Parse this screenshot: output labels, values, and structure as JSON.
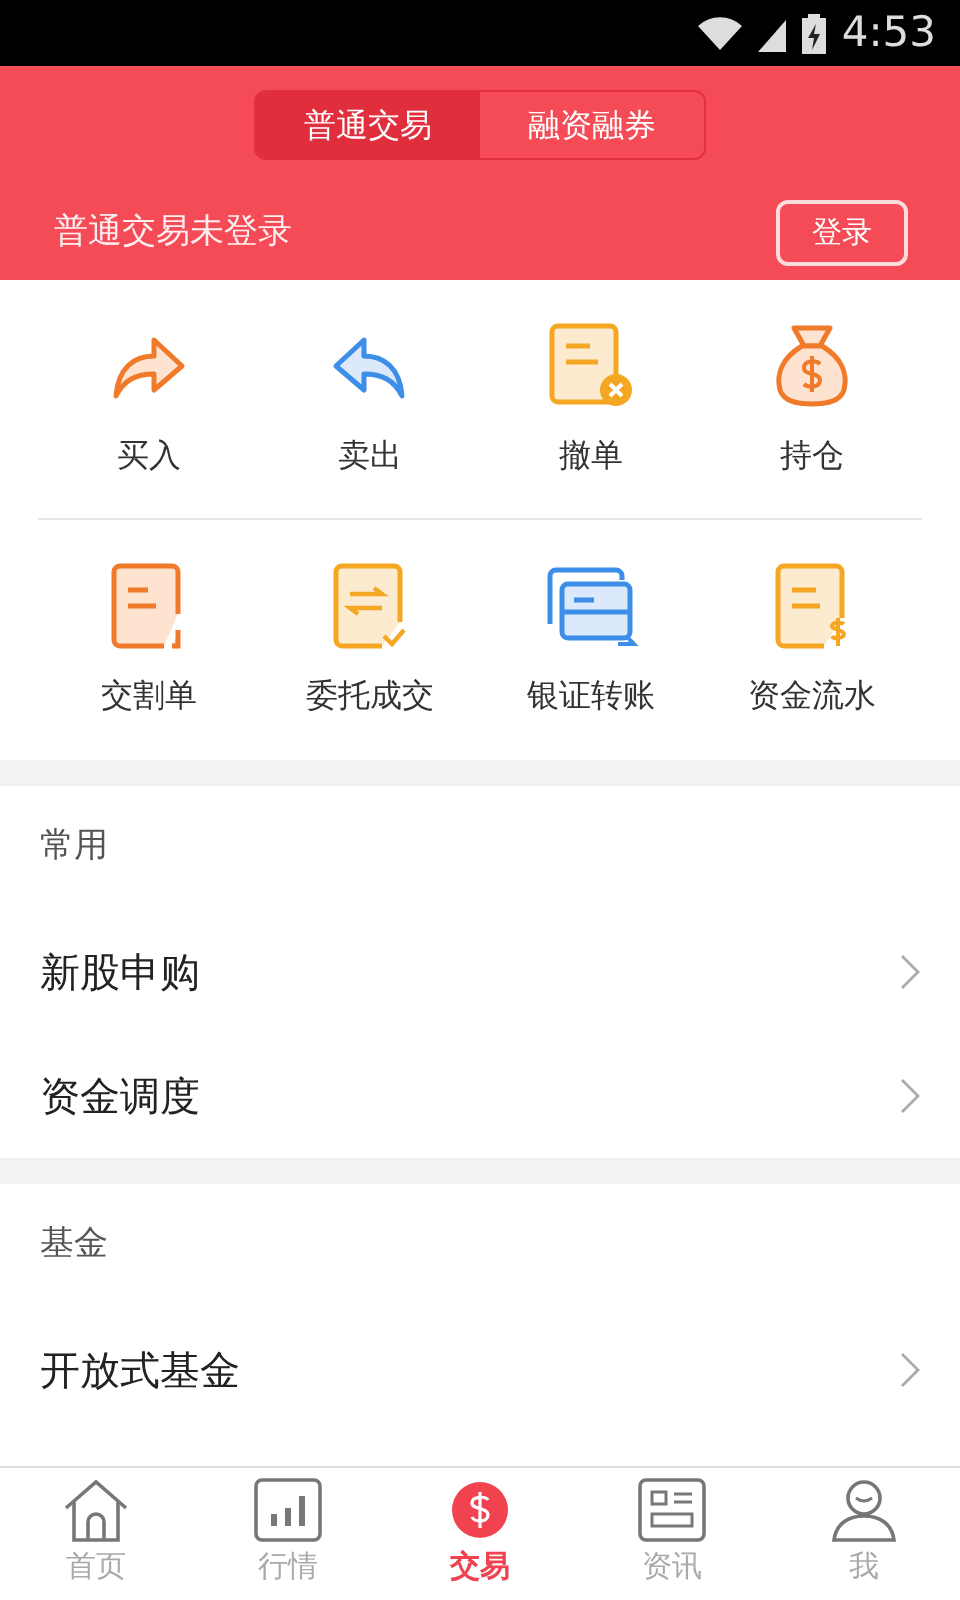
{
  "status_bar": {
    "time": "4:53"
  },
  "header": {
    "tabs": [
      {
        "label": "普通交易",
        "selected": true
      },
      {
        "label": "融资融券",
        "selected": false
      }
    ],
    "login_status": "普通交易未登录",
    "login_button": "登录"
  },
  "actions": [
    {
      "label": "买入",
      "kind": "buy"
    },
    {
      "label": "卖出",
      "kind": "sell"
    },
    {
      "label": "撤单",
      "kind": "cancel"
    },
    {
      "label": "持仓",
      "kind": "bag"
    },
    {
      "label": "交割单",
      "kind": "doc"
    },
    {
      "label": "委托成交",
      "kind": "swap"
    },
    {
      "label": "银证转账",
      "kind": "cards"
    },
    {
      "label": "资金流水",
      "kind": "ledger"
    }
  ],
  "sections": [
    {
      "title": "常用",
      "items": [
        "新股申购",
        "资金调度"
      ]
    },
    {
      "title": "基金",
      "items": [
        "开放式基金"
      ]
    }
  ],
  "bottom_nav": [
    {
      "label": "首页",
      "kind": "home",
      "selected": false
    },
    {
      "label": "行情",
      "kind": "chart",
      "selected": false
    },
    {
      "label": "交易",
      "kind": "trade",
      "selected": true
    },
    {
      "label": "资讯",
      "kind": "news",
      "selected": false
    },
    {
      "label": "我",
      "kind": "user",
      "selected": false
    }
  ]
}
